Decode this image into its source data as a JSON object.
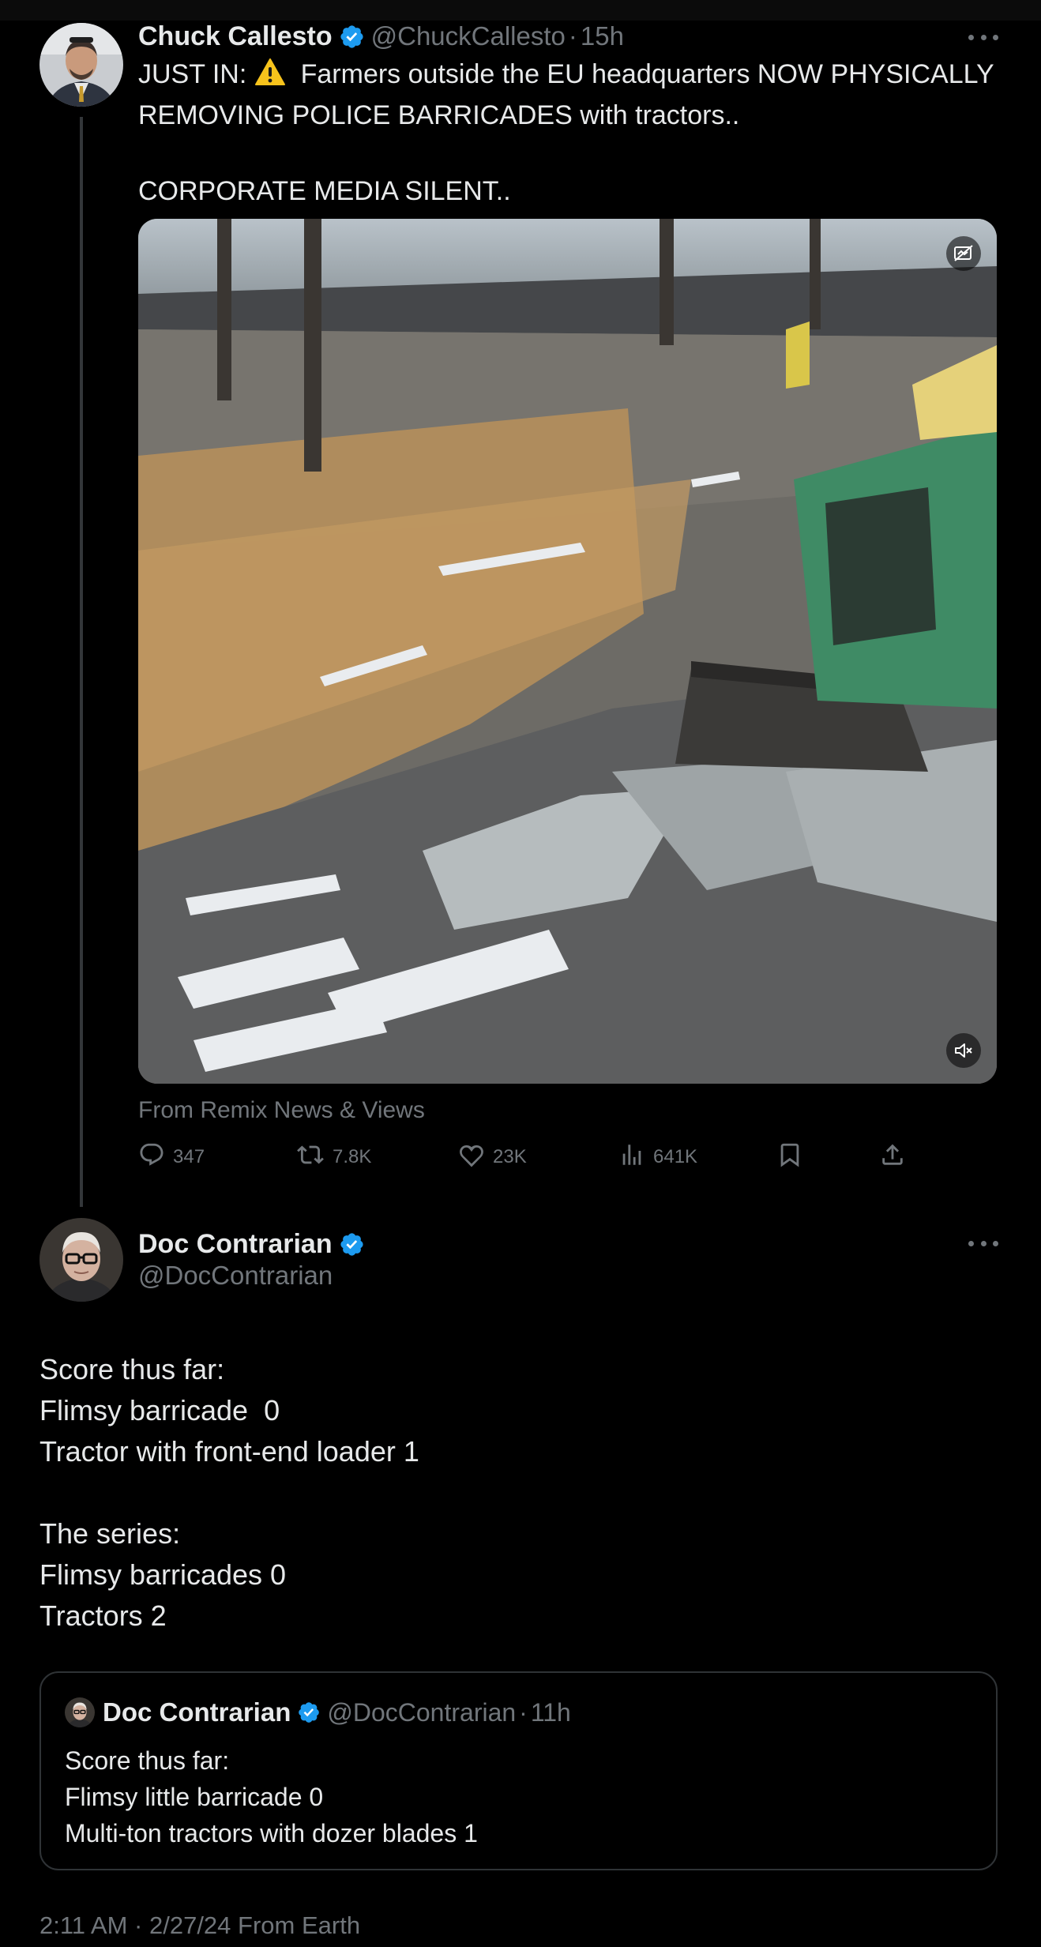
{
  "parent_tweet": {
    "author_name": "Chuck Callesto",
    "handle": "@ChuckCallesto",
    "separator": "·",
    "time_ago": "15h",
    "text_line1_prefix": "JUST IN: ",
    "text_line1_rest": "  Farmers outside the EU headquarters NOW PHYSICALLY",
    "text_line2": "REMOVING POLICE BARRICADES with tractors..",
    "text_line3": "CORPORATE MEDIA SILENT..",
    "media_source": "From Remix News & Views",
    "stats": {
      "replies": "347",
      "reposts": "7.8K",
      "likes": "23K",
      "views": "641K"
    }
  },
  "reply_tweet": {
    "author_name": "Doc Contrarian",
    "handle": "@DocContrarian",
    "lines": [
      "Score thus far:",
      "Flimsy barricade  0",
      "Tractor with front-end loader 1",
      "",
      "The series:",
      "Flimsy barricades 0",
      "Tractors 2"
    ],
    "quoted": {
      "author_name": "Doc Contrarian",
      "handle": "@DocContrarian",
      "separator": "·",
      "time_ago": "11h",
      "lines": [
        "Score thus far:",
        "Flimsy little barricade 0",
        "Multi-ton tractors with dozer blades 1"
      ]
    },
    "timestamp": "2:11 AM · 2/27/24 From Earth"
  },
  "colors": {
    "background": "#000000",
    "text": "#e7e9ea",
    "secondary": "#71767b",
    "verified": "#1d9bf0",
    "border": "#2f3336"
  },
  "icons": [
    "verified-badge-icon",
    "more-icon",
    "warning-icon",
    "gif-icon",
    "mute-icon",
    "reply-icon",
    "repost-icon",
    "like-icon",
    "views-icon",
    "bookmark-icon",
    "share-icon"
  ]
}
